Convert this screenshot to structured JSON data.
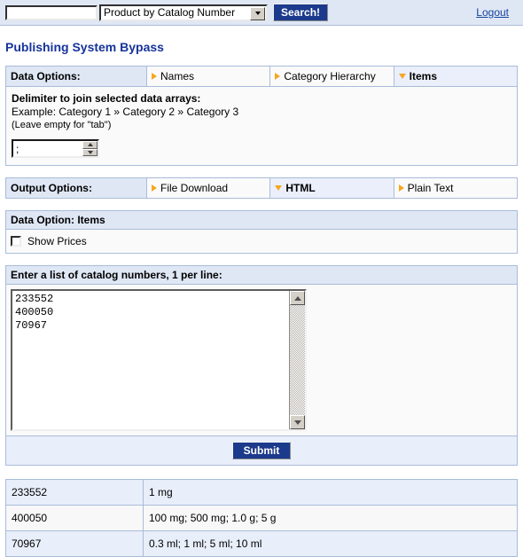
{
  "topbar": {
    "search_value": "",
    "search_placeholder": "",
    "search_scope": "Product by Catalog Number",
    "search_button": "Search!",
    "logout": "Logout"
  },
  "page_title": "Publishing System Bypass",
  "data_options": {
    "label": "Data Options:",
    "items": [
      {
        "label": "Names",
        "selected": false,
        "marker": "triangle-right-icon"
      },
      {
        "label": "Category Hierarchy",
        "selected": false,
        "marker": "triangle-right-icon"
      },
      {
        "label": "Items",
        "selected": true,
        "marker": "triangle-down-icon"
      }
    ]
  },
  "delimiter": {
    "title": "Delimiter to join selected data arrays:",
    "example": "Example: Category 1 » Category 2 » Category 3",
    "note": "(Leave empty for \"tab\")",
    "value": ";",
    "placeholder": ""
  },
  "output_options": {
    "label": "Output Options:",
    "items": [
      {
        "label": "File Download",
        "selected": false,
        "marker": "triangle-right-icon"
      },
      {
        "label": "HTML",
        "selected": true,
        "marker": "triangle-down-icon"
      },
      {
        "label": "Plain Text",
        "selected": false,
        "marker": "triangle-right-icon"
      }
    ]
  },
  "data_option_items": {
    "heading": "Data Option: Items",
    "checkbox_label": "Show Prices",
    "checkbox_checked": false
  },
  "catalog_input": {
    "heading": "Enter a list of catalog numbers, 1 per line:",
    "value": "233552\n400050\n70967",
    "placeholder": ""
  },
  "submit": {
    "label": "Submit"
  },
  "results": {
    "rows": [
      {
        "catalog": "233552",
        "sizes": "1 mg"
      },
      {
        "catalog": "400050",
        "sizes": "100 mg; 500 mg; 1.0 g; 5 g"
      },
      {
        "catalog": "70967",
        "sizes": "0.3 ml; 1 ml; 5 ml; 10 ml"
      }
    ]
  },
  "colors": {
    "header_blue": "#dfe7f5",
    "border_blue": "#a9bcd9",
    "accent_orange": "#f5a623",
    "button_navy": "#1b3a8c",
    "link_blue": "#16439c",
    "row_alt": "#e8eefa"
  }
}
